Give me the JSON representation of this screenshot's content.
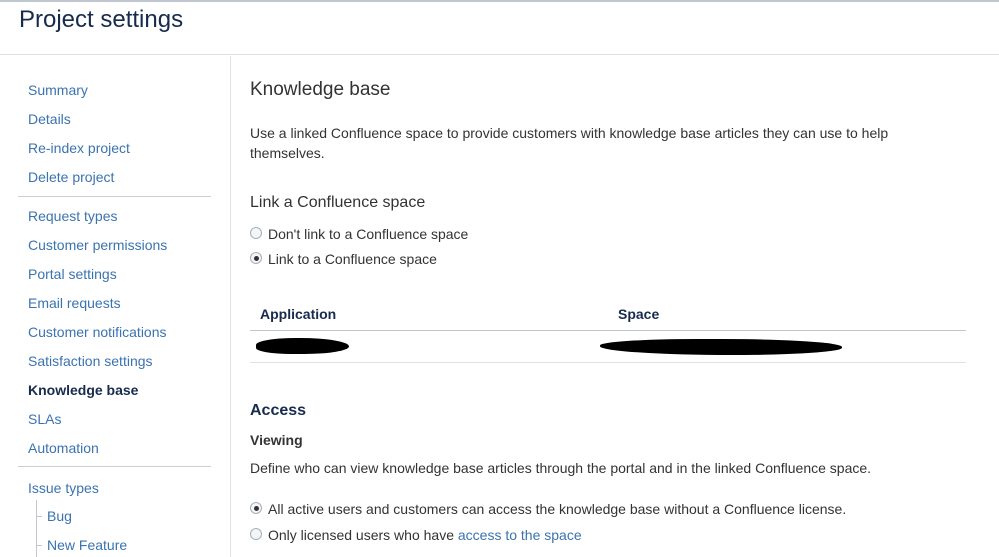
{
  "header": {
    "title": "Project settings"
  },
  "sidebar": {
    "group1": [
      "Summary",
      "Details",
      "Re-index project",
      "Delete project"
    ],
    "group2": [
      "Request types",
      "Customer permissions",
      "Portal settings",
      "Email requests",
      "Customer notifications",
      "Satisfaction settings",
      "Knowledge base",
      "SLAs",
      "Automation"
    ],
    "active_item": "Knowledge base",
    "group3": {
      "label": "Issue types",
      "children": [
        "Bug",
        "New Feature"
      ]
    }
  },
  "main": {
    "title": "Knowledge base",
    "description": "Use a linked Confluence space to provide customers with knowledge base articles they can use to help themselves.",
    "link_section": {
      "title": "Link a Confluence space",
      "options": [
        {
          "label": "Don't link to a Confluence space",
          "checked": false
        },
        {
          "label": "Link to a Confluence space",
          "checked": true
        }
      ]
    },
    "table": {
      "headers": [
        "Application",
        "Space"
      ]
    },
    "access": {
      "title": "Access",
      "viewing_title": "Viewing",
      "viewing_desc": "Define who can view knowledge base articles through the portal and in the linked Confluence space.",
      "options": [
        {
          "label": "All active users and customers can access the knowledge base without a Confluence license.",
          "checked": true
        },
        {
          "label": "Only licensed users who have ",
          "link": "access to the space",
          "checked": false
        }
      ]
    }
  },
  "colors": {
    "link": "#3b73af",
    "heading": "#172b4d",
    "text": "#333333",
    "divider": "#dfe1e6"
  }
}
